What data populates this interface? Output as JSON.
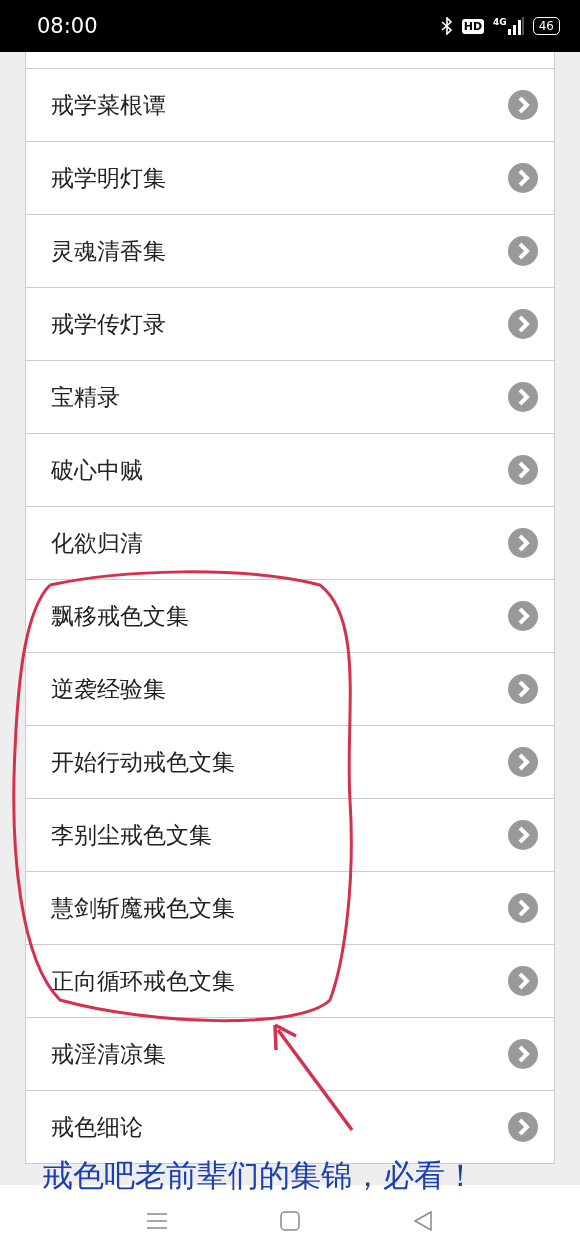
{
  "status_bar": {
    "time": "08:00",
    "hd_label": "HD",
    "network_label": "4G",
    "battery": "46"
  },
  "list": {
    "items": [
      {
        "title": "戒学菜根谭"
      },
      {
        "title": "戒学明灯集"
      },
      {
        "title": "灵魂清香集"
      },
      {
        "title": "戒学传灯录"
      },
      {
        "title": "宝精录"
      },
      {
        "title": "破心中贼"
      },
      {
        "title": "化欲归清"
      },
      {
        "title": "飘移戒色文集"
      },
      {
        "title": "逆袭经验集"
      },
      {
        "title": "开始行动戒色文集"
      },
      {
        "title": "李别尘戒色文集"
      },
      {
        "title": "慧剑斩魔戒色文集"
      },
      {
        "title": "正向循环戒色文集"
      },
      {
        "title": "戒淫清凉集"
      },
      {
        "title": "戒色细论"
      }
    ]
  },
  "annotation": {
    "caption": "戒色吧老前辈们的集锦，必看！"
  }
}
